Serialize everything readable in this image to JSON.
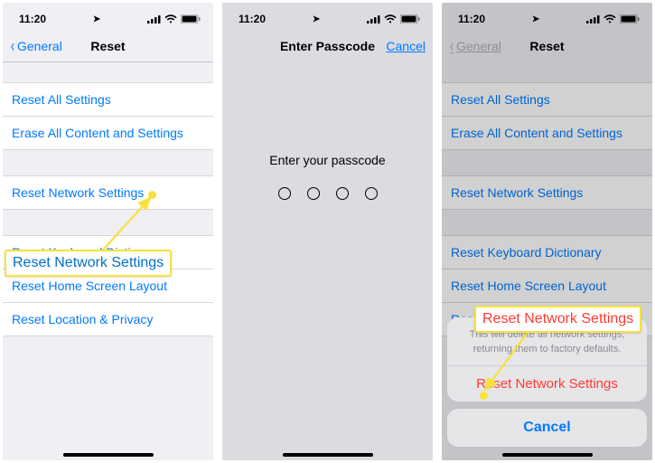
{
  "status": {
    "time": "11:20",
    "loc_icon": "➤"
  },
  "screen1": {
    "back": "General",
    "title": "Reset",
    "group1": [
      "Reset All Settings",
      "Erase All Content and Settings"
    ],
    "group2": [
      "Reset Network Settings"
    ],
    "group3": [
      "Reset Keyboard Dictionary",
      "Reset Home Screen Layout",
      "Reset Location & Privacy"
    ],
    "callout": "Reset Network Settings"
  },
  "screen2": {
    "title": "Enter Passcode",
    "cancel": "Cancel",
    "prompt": "Enter your passcode"
  },
  "screen3": {
    "back": "General",
    "title": "Reset",
    "group1": [
      "Reset All Settings",
      "Erase All Content and Settings"
    ],
    "group2": [
      "Reset Network Settings"
    ],
    "group3": [
      "Reset Keyboard Dictionary",
      "Reset Home Screen Layout",
      "Reset Location & Privacy"
    ],
    "callout": "Reset Network Settings",
    "sheet": {
      "message": "This will delete all network settings, returning them to factory defaults.",
      "confirm": "Reset Network Settings",
      "cancel": "Cancel"
    }
  }
}
